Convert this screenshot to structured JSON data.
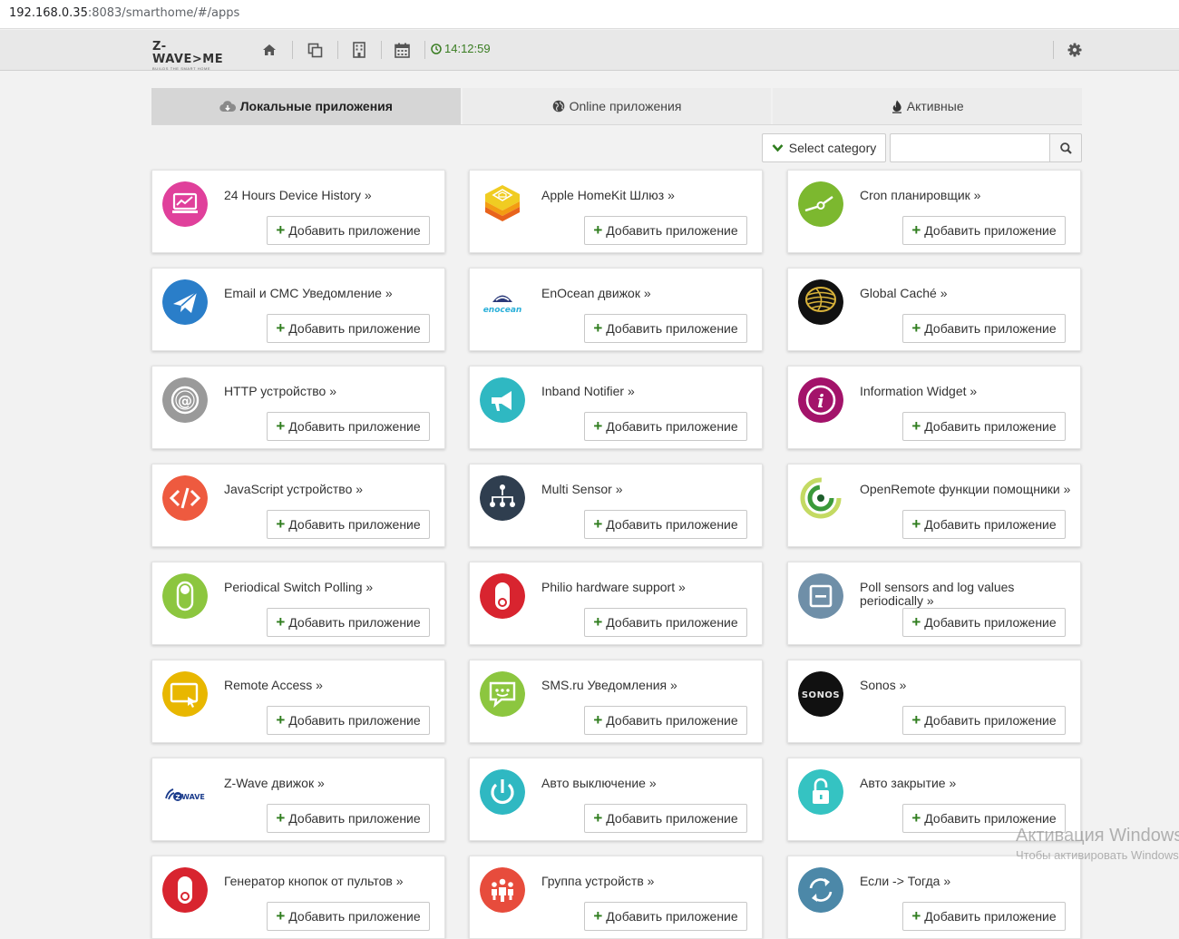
{
  "browser": {
    "address_host": "192.168.0.35",
    "address_path": ":8083/smarthome/#/apps"
  },
  "navbar": {
    "logo_text": "Z-WAVE>ME",
    "logo_tagline": "BUILDS THE SMART HOME",
    "items": [
      {
        "name": "home",
        "icon": "home-icon"
      },
      {
        "name": "elements",
        "icon": "copy-icon"
      },
      {
        "name": "rooms",
        "icon": "building-icon"
      },
      {
        "name": "events",
        "icon": "calendar-icon"
      }
    ],
    "clock": "14:12:59",
    "settings_icon": "gear-icon",
    "clock_color": "#3a7d22"
  },
  "tabs": [
    {
      "label": "Локальные приложения",
      "icon": "cloud-download-icon",
      "active": true
    },
    {
      "label": "Online приложения",
      "icon": "globe-icon",
      "active": false
    },
    {
      "label": "Активные",
      "icon": "fire-icon",
      "active": false
    }
  ],
  "filter": {
    "category_label": "Select category",
    "search_placeholder": "",
    "search_icon": "search-icon"
  },
  "apps": [
    {
      "title": "24 Hours Device History »",
      "icon": "monitor-chart-icon",
      "color": "#e0409b",
      "button": "Добавить приложение"
    },
    {
      "title": "Apple HomeKit Шлюз »",
      "icon": "homekit-icon",
      "color": "#f6a31a",
      "button": "Добавить приложение"
    },
    {
      "title": "Cron планировщик »",
      "icon": "cron-icon",
      "color": "#7cb82f",
      "button": "Добавить приложение"
    },
    {
      "title": "Email и СМС Уведомление »",
      "icon": "mail-icon",
      "color": "#2a7ec9",
      "button": "Добавить приложение"
    },
    {
      "title": "EnOcean движок »",
      "icon": "enocean-icon",
      "color": "#ffffff",
      "button": "Добавить приложение"
    },
    {
      "title": "Global Caché »",
      "icon": "globalcache-icon",
      "color": "#111111",
      "button": "Добавить приложение"
    },
    {
      "title": "HTTP устройство »",
      "icon": "at-icon",
      "color": "#9a9a9a",
      "button": "Добавить приложение"
    },
    {
      "title": "Inband Notifier »",
      "icon": "megaphone-icon",
      "color": "#2fb8c2",
      "button": "Добавить приложение"
    },
    {
      "title": "Information Widget »",
      "icon": "info-icon",
      "color": "#a3136a",
      "button": "Добавить приложение"
    },
    {
      "title": "JavaScript устройство »",
      "icon": "code-icon",
      "color": "#ee5a3f",
      "button": "Добавить приложение"
    },
    {
      "title": "Multi Sensor »",
      "icon": "hierarchy-icon",
      "color": "#2f3e4f",
      "button": "Добавить приложение"
    },
    {
      "title": "OpenRemote функции помощники »",
      "icon": "openremote-icon",
      "color": "#ffffff",
      "button": "Добавить приложение"
    },
    {
      "title": "Periodical Switch Polling »",
      "icon": "toggle-icon",
      "color": "#8cc63f",
      "button": "Добавить приложение"
    },
    {
      "title": "Philio hardware support »",
      "icon": "toggle-red-icon",
      "color": "#d8242f",
      "button": "Добавить приложение"
    },
    {
      "title": "Poll sensors and log values periodically »",
      "icon": "sensor-icon",
      "color": "#6f8fa8",
      "button": "Добавить приложение"
    },
    {
      "title": "Remote Access »",
      "icon": "remote-screen-icon",
      "color": "#e8b700",
      "button": "Добавить приложение"
    },
    {
      "title": "SMS.ru Уведомления »",
      "icon": "chat-icon",
      "color": "#8cc63f",
      "button": "Добавить приложение"
    },
    {
      "title": "Sonos »",
      "icon": "sonos-icon",
      "color": "#111111",
      "button": "Добавить приложение"
    },
    {
      "title": "Z-Wave движок »",
      "icon": "zwave-icon",
      "color": "#ffffff",
      "button": "Добавить приложение"
    },
    {
      "title": "Авто выключение »",
      "icon": "power-icon",
      "color": "#2fb8c2",
      "button": "Добавить приложение"
    },
    {
      "title": "Авто закрытие »",
      "icon": "lock-icon",
      "color": "#35c3c2",
      "button": "Добавить приложение"
    },
    {
      "title": "Генератор кнопок от пультов »",
      "icon": "toggle-red-icon",
      "color": "#d8242f",
      "button": "Добавить приложение"
    },
    {
      "title": "Группа устройств »",
      "icon": "group-icon",
      "color": "#e74c3c",
      "button": "Добавить приложение"
    },
    {
      "title": "Если -> Тогда »",
      "icon": "refresh-icon",
      "color": "#4c88a8",
      "button": "Добавить приложение"
    }
  ],
  "watermark": {
    "line1": "Активация Windows",
    "line2": "Чтобы активировать Windows"
  }
}
